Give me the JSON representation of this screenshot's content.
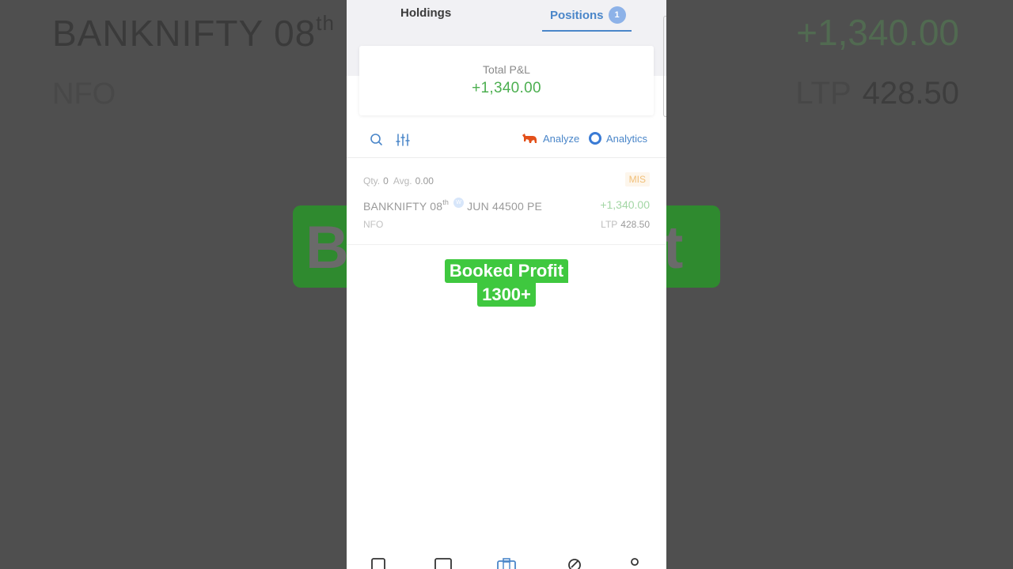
{
  "background": {
    "symbol_prefix": "BANKNIFTY 08",
    "symbol_sup": "th",
    "exchange": "NFO",
    "pnl": "+1,340.00",
    "ltp_label": "LTP",
    "ltp_value": "428.50",
    "badge_left_char": "B",
    "badge_right_char": "t"
  },
  "tabs": {
    "holdings": "Holdings",
    "positions": "Positions",
    "positions_count": "1"
  },
  "summary": {
    "label": "Total P&L",
    "value": "+1,340.00"
  },
  "toolbar": {
    "analyze": "Analyze",
    "analytics": "Analytics"
  },
  "position": {
    "qty_label": "Qty.",
    "qty": "0",
    "avg_label": "Avg.",
    "avg": "0.00",
    "product": "MIS",
    "symbol_prefix": "BANKNIFTY 08",
    "symbol_sup": "th",
    "weekly_badge": "W",
    "symbol_suffix": "JUN 44500 PE",
    "pnl": "+1,340.00",
    "exchange": "NFO",
    "ltp_label": "LTP",
    "ltp": "428.50"
  },
  "overlay": {
    "line1": "Booked Profit",
    "line2": "1300+"
  },
  "icons": [
    "search-icon",
    "filter-icon",
    "bull-icon",
    "analytics-ring-icon",
    "watchlist-icon",
    "orders-icon",
    "portfolio-icon",
    "bids-icon",
    "profile-icon"
  ],
  "colors": {
    "accent": "#4a86c9",
    "profit": "#4caf50",
    "overlay_green": "#3fc83f"
  }
}
